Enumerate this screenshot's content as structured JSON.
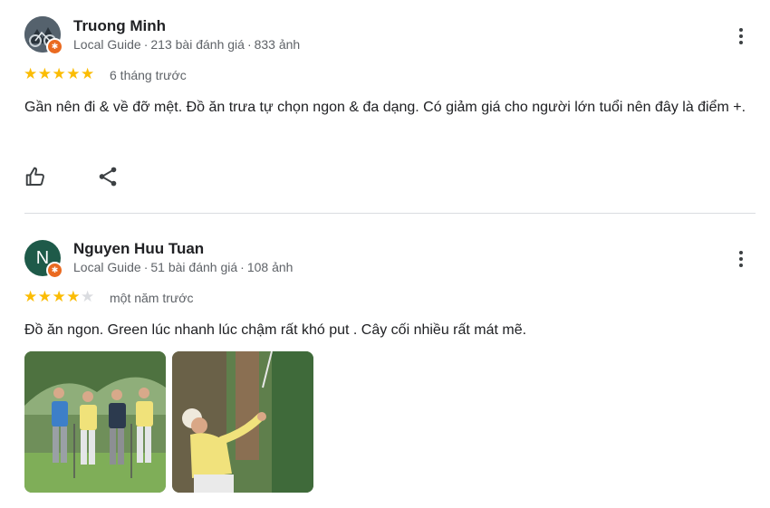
{
  "reviews": [
    {
      "author": "Truong Minh",
      "role": "Local Guide",
      "review_count": "213 bài đánh giá",
      "photo_count": "833 ảnh",
      "rating": 5,
      "time": "6 tháng trước",
      "text": "Gần nên đi & về đỡ mệt. Đồ ăn trưa tự chọn ngon & đa dạng. Có giảm giá cho người lớn tuổi nên đây là điểm +."
    },
    {
      "author": "Nguyen Huu Tuan",
      "avatar_letter": "N",
      "avatar_color": "#1e5a49",
      "role": "Local Guide",
      "review_count": "51 bài đánh giá",
      "photo_count": "108 ảnh",
      "rating": 4,
      "time": "một năm trước",
      "text": "Đồ ăn ngon. Green lúc nhanh lúc chậm rất khó put . Cây cối nhiều rất mát mẽ."
    }
  ],
  "icons": {
    "like": "thumb-up-icon",
    "share": "share-icon",
    "more": "more-vert-icon",
    "badge": "local-guide-badge-icon",
    "star": "star-icon"
  },
  "colors": {
    "star_filled": "#fbbc04",
    "star_empty": "#dadce0",
    "badge": "#ea6a20",
    "divider": "#dadce0"
  },
  "separator": "·"
}
